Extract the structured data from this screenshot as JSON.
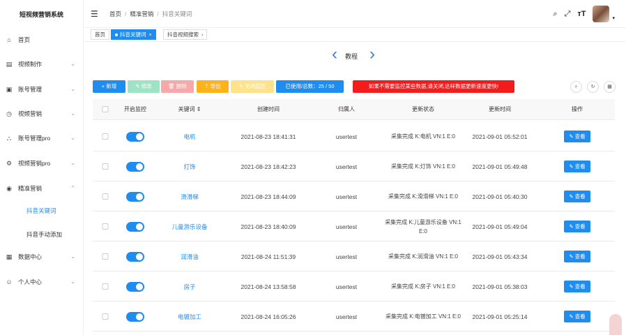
{
  "sidebar": {
    "title": "短视频营销系统",
    "items": [
      {
        "icon": "home-icon",
        "glyph": "⌂",
        "label": "首页",
        "chevron": ""
      },
      {
        "icon": "video-icon",
        "glyph": "▤",
        "label": "视频制作",
        "chevron": "⌄"
      },
      {
        "icon": "account-icon",
        "glyph": "▣",
        "label": "账号管理",
        "chevron": "⌄"
      },
      {
        "icon": "clock-icon",
        "glyph": "◷",
        "label": "视频营销",
        "chevron": "⌄"
      },
      {
        "icon": "tree-icon",
        "glyph": "⛬",
        "label": "账号管理pro",
        "chevron": "⌄"
      },
      {
        "icon": "gear-icon",
        "glyph": "⚙",
        "label": "视频营销pro",
        "chevron": "⌄"
      },
      {
        "icon": "marker-icon",
        "glyph": "◉",
        "label": "精准营销",
        "chevron": "⌃"
      }
    ],
    "sub_items": [
      {
        "label": "抖音关键词",
        "active": true
      },
      {
        "label": "抖音手动添加",
        "active": false
      }
    ],
    "bottom_items": [
      {
        "icon": "data-icon",
        "glyph": "▦",
        "label": "数据中心",
        "chevron": "⌄"
      },
      {
        "icon": "user-icon",
        "glyph": "☺",
        "label": "个人中心",
        "chevron": "⌄"
      }
    ]
  },
  "header": {
    "breadcrumb": [
      "首页",
      "精准营销",
      "抖音关键词"
    ],
    "icons": [
      "search-icon",
      "fullscreen-icon",
      "font-size-icon"
    ]
  },
  "tags": [
    {
      "label": "首页",
      "active": false,
      "closable": false
    },
    {
      "label": "抖音关键词",
      "active": true,
      "closable": true
    },
    {
      "label": "抖音视频搜索",
      "active": false,
      "closable": true
    }
  ],
  "tutorial": {
    "label": "教程"
  },
  "toolbar": {
    "add": "+ 新增",
    "edit": "✎ 修改",
    "delete": "🗑 删除",
    "import": "⇡ 导出",
    "close_monitor": "✎ 关闭监控",
    "quota": "已使用/总数：25 / 50",
    "warning": "如果不需要监控某些数据,请关闭,这样数据更新速度更快!"
  },
  "table": {
    "headers": [
      "开启监控",
      "关键词 ⇕",
      "创建时间",
      "归属人",
      "更新状态",
      "更新时间",
      "操作"
    ],
    "rows": [
      {
        "keyword": "电机",
        "created": "2021-08-23 18:41:31",
        "owner": "usertest",
        "status": "采集完成 K:电机 VN:1 E:0",
        "updated": "2021-09-01 05:52:01",
        "action": "✎ 查看"
      },
      {
        "keyword": "灯饰",
        "created": "2021-08-23 18:42:23",
        "owner": "usertest",
        "status": "采集完成 K:灯饰 VN:1 E:0",
        "updated": "2021-09-01 05:49:48",
        "action": "✎ 查看"
      },
      {
        "keyword": "滑滑梯",
        "created": "2021-08-23 18:44:09",
        "owner": "usertest",
        "status": "采集完成 K:滑滑梯 VN:1 E:0",
        "updated": "2021-09-01 05:40:30",
        "action": "✎ 查看"
      },
      {
        "keyword": "儿童游乐设备",
        "created": "2021-08-23 18:40:09",
        "owner": "usertest",
        "status": "采集完成 K:儿童游乐设备 VN:1 E:0",
        "updated": "2021-09-01 05:49:04",
        "action": "✎ 查看"
      },
      {
        "keyword": "润滑油",
        "created": "2021-08-24 11:51:39",
        "owner": "usertest",
        "status": "采集完成 K:润滑油 VN:1 E:0",
        "updated": "2021-09-01 05:43:34",
        "action": "✎ 查看"
      },
      {
        "keyword": "房子",
        "created": "2021-08-24 13:58:58",
        "owner": "usertest",
        "status": "采集完成 K:房子 VN:1 E:0",
        "updated": "2021-09-01 05:38:03",
        "action": "✎ 查看"
      },
      {
        "keyword": "电镀加工",
        "created": "2021-08-24 16:05:26",
        "owner": "usertest",
        "status": "采集完成 K:电镀加工 VN:1 E:0",
        "updated": "2021-09-01 05:25:14",
        "action": "✎ 查看"
      }
    ]
  }
}
